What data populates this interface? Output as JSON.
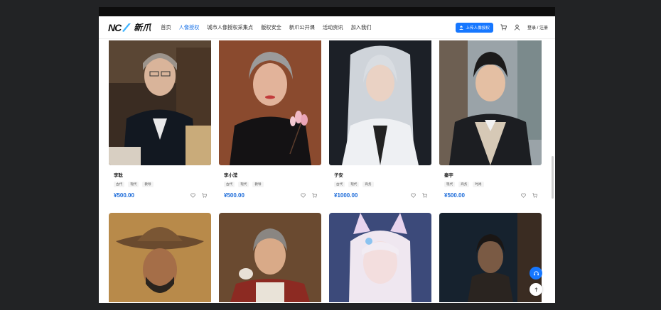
{
  "brand": {
    "logo_text": "NC",
    "logo_cn": "新爪"
  },
  "nav": {
    "items": [
      "首页",
      "人像授权",
      "城市人像授权采集点",
      "版权安全",
      "新爪公开课",
      "活动资讯",
      "加入我们"
    ],
    "active_index": 1,
    "upload_label": "上传人像授权",
    "login_label": "登录 / 注册"
  },
  "colors": {
    "accent": "#1a73e8",
    "price": "#1a6ad9",
    "button": "#1677ff"
  },
  "cards": [
    {
      "name": "李耽",
      "tags": [
        "古代",
        "现代",
        "教导"
      ],
      "price": "¥500.00"
    },
    {
      "name": "李小滢",
      "tags": [
        "古代",
        "现代",
        "教导"
      ],
      "price": "¥500.00"
    },
    {
      "name": "子安",
      "tags": [
        "古代",
        "现代",
        "商务"
      ],
      "price": "¥1000.00"
    },
    {
      "name": "秦宇",
      "tags": [
        "现代",
        "商务",
        "时尚"
      ],
      "price": "¥500.00"
    }
  ],
  "icons": {
    "favorite": "heart-icon",
    "cart": "cart-icon",
    "support": "headset-icon",
    "top": "arrow-up-icon",
    "user": "user-icon"
  }
}
